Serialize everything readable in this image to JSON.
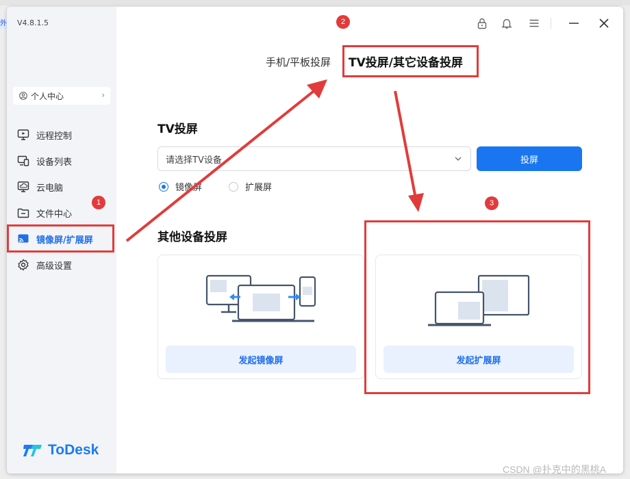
{
  "app": {
    "version": "V4.8.1.5",
    "brand": "ToDesk",
    "side_tag": "外"
  },
  "sidebar": {
    "personal_center": "个人中心",
    "items": [
      {
        "label": "远程控制",
        "icon": "remote-control-icon"
      },
      {
        "label": "设备列表",
        "icon": "device-list-icon"
      },
      {
        "label": "云电脑",
        "icon": "cloud-pc-icon"
      },
      {
        "label": "文件中心",
        "icon": "folder-icon"
      },
      {
        "label": "镜像屏/扩展屏",
        "icon": "screen-cast-icon",
        "active": true
      },
      {
        "label": "高级设置",
        "icon": "gear-icon"
      }
    ]
  },
  "tabs": {
    "tab1": "手机/平板投屏",
    "tab2": "TV投屏/其它设备投屏",
    "active": "tab2"
  },
  "tv": {
    "heading": "TV投屏",
    "select_value": "请选择TV设备",
    "cast_button": "投屏",
    "radio_mirror": "镜像屏",
    "radio_extend": "扩展屏",
    "selected": "镜像屏"
  },
  "other": {
    "heading": "其他设备投屏",
    "mirror_button": "发起镜像屏",
    "extend_button": "发起扩展屏"
  },
  "annotations": {
    "badge1": "1",
    "badge2": "2",
    "badge3": "3"
  },
  "watermark": "CSDN @扑克中的黑桃A",
  "colors": {
    "accent": "#1976f0",
    "annotation_red": "#e23b3b",
    "logo": "#1a7bf5"
  }
}
